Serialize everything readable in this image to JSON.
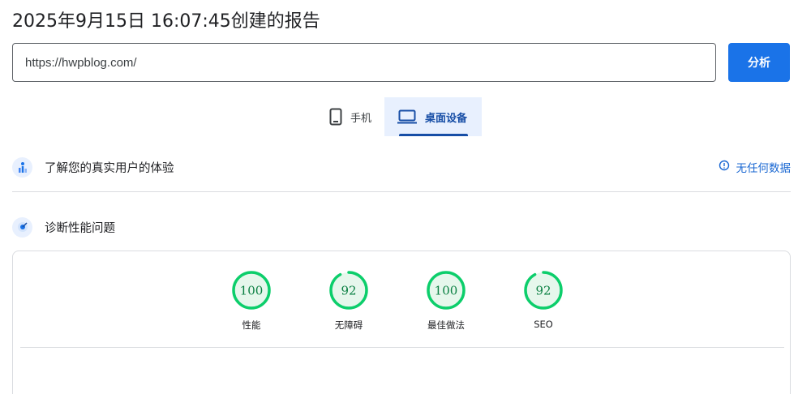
{
  "header": {
    "title": "2025年9月15日 16:07:45创建的报告"
  },
  "search": {
    "url_value": "https://hwpblog.com/",
    "analyze_label": "分析"
  },
  "tabs": [
    {
      "label": "手机",
      "icon": "smartphone-icon",
      "active": false
    },
    {
      "label": "桌面设备",
      "icon": "laptop-icon",
      "active": true
    }
  ],
  "field_data": {
    "label": "了解您的真实用户的体验",
    "icon": "users-chart-icon",
    "no_data_label": "无任何数据",
    "no_data_icon": "info-icon"
  },
  "diagnostics": {
    "label": "诊断性能问题",
    "icon": "lighthouse-icon"
  },
  "scores": [
    {
      "label": "性能",
      "value": "100",
      "fraction": 1.0
    },
    {
      "label": "无障碍",
      "value": "92",
      "fraction": 0.92
    },
    {
      "label": "最佳做法",
      "value": "100",
      "fraction": 1.0
    },
    {
      "label": "SEO",
      "value": "92",
      "fraction": 0.92
    }
  ],
  "colors": {
    "accent": "#1a73e8",
    "pass": "#0cce6b",
    "pass_bg": "#e6f7ec",
    "pass_text": "#0b8043"
  }
}
